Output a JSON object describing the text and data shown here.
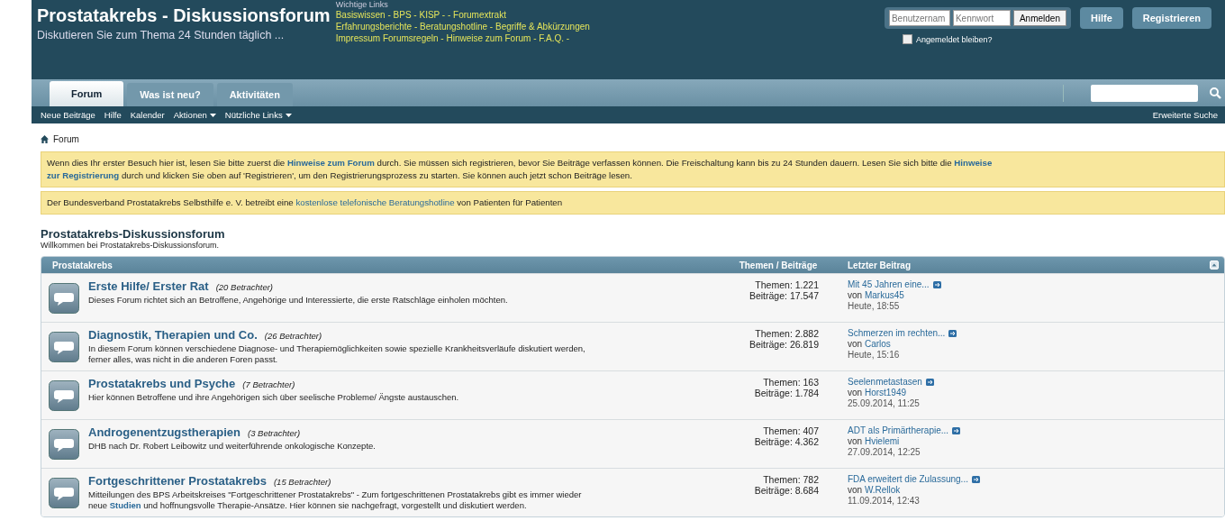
{
  "header": {
    "title": "Prostatakrebs - Diskussionsforum",
    "tagline": "Diskutieren Sie zum Thema 24 Stunden täglich ...",
    "links_heading": "Wichtige Links",
    "link_lines": [
      "Basiswissen - BPS - KISP - - Forumextrakt",
      "Erfahrungsberichte - Beratungshotline - Begriffe & Abkürzungen",
      "Impressum Forumsregeln - Hinweise zum Forum - F.A.Q. -"
    ]
  },
  "login": {
    "username_placeholder": "Benutzernam",
    "password_placeholder": "Kennwort",
    "button": "Anmelden",
    "remember_label": "Angemeldet bleiben?",
    "remember_checked": false
  },
  "header_buttons": [
    "Hilfe",
    "Registrieren"
  ],
  "tabs": [
    {
      "label": "Forum",
      "selected": true
    },
    {
      "label": "Was ist neu?",
      "selected": false
    },
    {
      "label": "Aktivitäten",
      "selected": false
    }
  ],
  "subnav": [
    {
      "label": "Neue Beiträge",
      "dropdown": false
    },
    {
      "label": "Hilfe",
      "dropdown": false
    },
    {
      "label": "Kalender",
      "dropdown": false
    },
    {
      "label": "Aktionen",
      "dropdown": true
    },
    {
      "label": "Nützliche Links",
      "dropdown": true
    }
  ],
  "advanced_search": "Erweiterte Suche",
  "breadcrumb": "Forum",
  "notices": [
    [
      [
        {
          "kind": "text",
          "text": "Wenn dies Ihr erster Besuch hier ist, lesen Sie bitte zuerst die "
        },
        {
          "kind": "link",
          "bold": true,
          "text": "Hinweise zum Forum"
        },
        {
          "kind": "text",
          "text": " durch. Sie müssen sich registrieren, bevor Sie Beiträge verfassen können. Die Freischaltung kann bis zu 24 Stunden dauern. Lesen Sie sich bitte die "
        },
        {
          "kind": "link",
          "bold": true,
          "text": "Hinweise"
        }
      ],
      [
        {
          "kind": "link",
          "bold": true,
          "text": "zur Registrierung"
        },
        {
          "kind": "text",
          "text": " durch und klicken Sie oben auf 'Registrieren', um den Registrierungsprozess zu starten. Sie können auch jetzt schon Beiträge lesen."
        }
      ]
    ],
    [
      [
        {
          "kind": "text",
          "text": "Der Bundesverband Prostatakrebs Selbsthilfe e. V. betreibt eine "
        },
        {
          "kind": "link",
          "bold": false,
          "text": "kostenlose telefonische Beratungshotline"
        },
        {
          "kind": "text",
          "text": " von Patienten für Patienten"
        }
      ]
    ]
  ],
  "forum": {
    "title": "Prostatakrebs-Diskussionsforum",
    "subtitle": "Willkommen bei Prostatakrebs-Diskussionsforum.",
    "columns": [
      "Prostatakrebs",
      "Themen / Beiträge",
      "Letzter Beitrag"
    ],
    "rows": [
      {
        "title": "Erste Hilfe/ Erster Rat",
        "viewers": "(20 Betrachter)",
        "description": [
          [
            {
              "kind": "text",
              "text": "Dieses Forum richtet sich an Betroffene, Angehörige und Interessierte, die erste Ratschläge einholen möchten."
            }
          ]
        ],
        "stats": [
          "Themen: 1.221",
          "Beiträge: 17.547"
        ],
        "last": {
          "title": "Mit 45 Jahren eine...",
          "prefix": "von",
          "user": "Markus45",
          "time": "Heute, 18:55"
        }
      },
      {
        "title": "Diagnostik, Therapien und Co.",
        "viewers": "(26 Betrachter)",
        "description": [
          [
            {
              "kind": "text",
              "text": "In diesem Forum können verschiedene Diagnose- und Therapiemöglichkeiten sowie spezielle Krankheitsverläufe diskutiert werden,"
            }
          ],
          [
            {
              "kind": "text",
              "text": "ferner alles, was nicht in die anderen Foren passt."
            }
          ]
        ],
        "stats": [
          "Themen: 2.882",
          "Beiträge: 26.819"
        ],
        "last": {
          "title": "Schmerzen im rechten...",
          "prefix": "von",
          "user": "Carlos",
          "time": "Heute, 15:16"
        }
      },
      {
        "title": "Prostatakrebs und Psyche",
        "viewers": "(7 Betrachter)",
        "description": [
          [
            {
              "kind": "text",
              "text": "Hier können Betroffene und ihre Angehörigen sich über seelische Probleme/ Ängste austauschen."
            }
          ]
        ],
        "stats": [
          "Themen: 163",
          "Beiträge: 1.784"
        ],
        "last": {
          "title": "Seelenmetastasen",
          "prefix": "von",
          "user": "Horst1949",
          "time": "25.09.2014, 11:25"
        }
      },
      {
        "title": "Androgenentzugstherapien",
        "viewers": "(3 Betrachter)",
        "description": [
          [
            {
              "kind": "text",
              "text": "DHB nach Dr. Robert Leibowitz und weiterführende onkologische Konzepte."
            }
          ]
        ],
        "stats": [
          "Themen: 407",
          "Beiträge: 4.362"
        ],
        "last": {
          "title": "ADT als Primärtherapie...",
          "prefix": "von",
          "user": "Hvielemi",
          "time": "27.09.2014, 12:25"
        }
      },
      {
        "title": "Fortgeschrittener Prostatakrebs",
        "viewers": "(15 Betrachter)",
        "description": [
          [
            {
              "kind": "text",
              "text": "Mitteilungen des BPS Arbeitskreises \"Fortgeschrittener Prostatakrebs\" - Zum fortgeschrittenen Prostatakrebs gibt es immer wieder"
            }
          ],
          [
            {
              "kind": "text",
              "text": "neue "
            },
            {
              "kind": "link",
              "bold": true,
              "text": "Studien"
            },
            {
              "kind": "text",
              "text": " und hoffnungsvolle Therapie-Ansätze. Hier können sie nachgefragt, vorgestellt und diskutiert werden."
            }
          ]
        ],
        "stats": [
          "Themen: 782",
          "Beiträge: 8.684"
        ],
        "last": {
          "title": "FDA erweitert die Zulassung...",
          "prefix": "von",
          "user": "W.Rellok",
          "time": "11.09.2014, 12:43"
        }
      }
    ]
  }
}
